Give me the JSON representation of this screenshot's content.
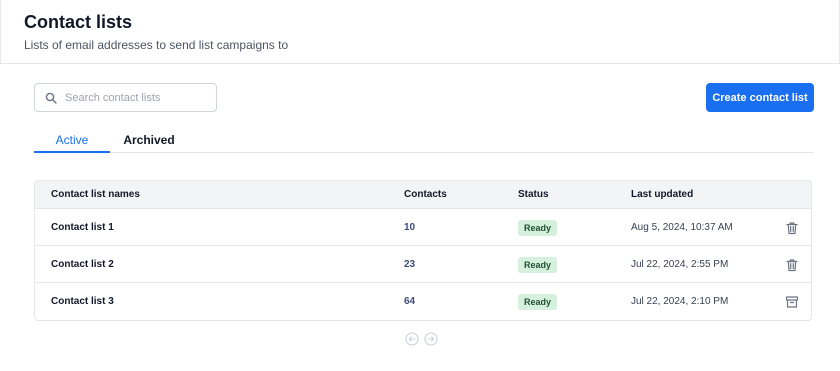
{
  "header": {
    "title": "Contact lists",
    "subtitle": "Lists of email addresses to send list campaigns to"
  },
  "search": {
    "placeholder": "Search contact lists",
    "value": ""
  },
  "toolbar": {
    "create_label": "Create contact list"
  },
  "tabs": [
    {
      "label": "Active",
      "active": true
    },
    {
      "label": "Archived",
      "active": false
    }
  ],
  "table": {
    "columns": [
      "Contact list names",
      "Contacts",
      "Status",
      "Last updated"
    ],
    "rows": [
      {
        "name": "Contact list 1",
        "contacts": "10",
        "status": "Ready",
        "updated": "Aug 5, 2024, 10:37 AM",
        "action_icon": "trash-icon"
      },
      {
        "name": "Contact list 2",
        "contacts": "23",
        "status": "Ready",
        "updated": "Jul 22, 2024, 2:55 PM",
        "action_icon": "trash-icon"
      },
      {
        "name": "Contact list 3",
        "contacts": "64",
        "status": "Ready",
        "updated": "Jul 22, 2024, 2:10 PM",
        "action_icon": "archive-icon"
      }
    ]
  },
  "colors": {
    "accent": "#1a6ff0",
    "status_bg": "#d6f0de",
    "status_text": "#1f5130",
    "header_row_bg": "#f3f4f6"
  }
}
